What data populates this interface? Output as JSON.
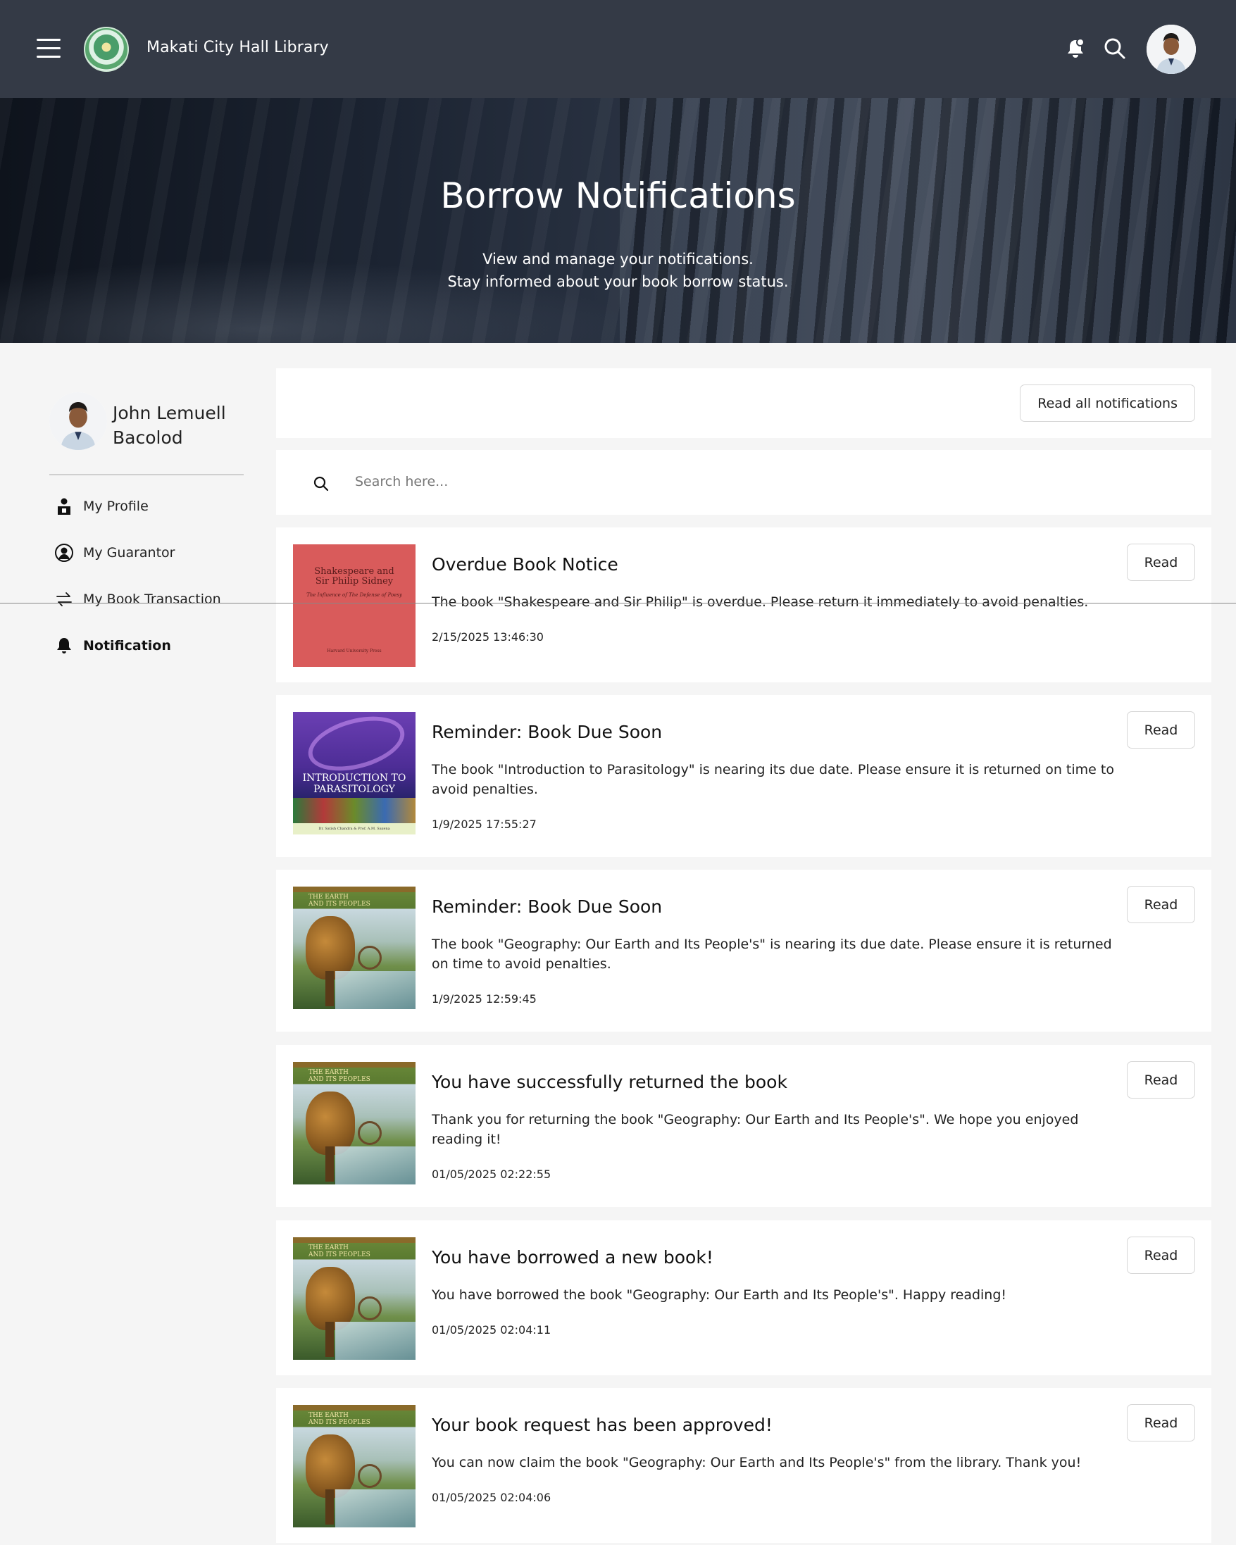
{
  "header": {
    "app_title": "Makati City Hall Library",
    "icons": [
      "menu-icon",
      "logo",
      "bell-icon",
      "search-icon",
      "avatar"
    ]
  },
  "hero": {
    "title": "Borrow Notifications",
    "subtitle_line1": "View and manage your notifications.",
    "subtitle_line2": "Stay informed about your book borrow status."
  },
  "sidebar": {
    "user_name": "John Lemuell Bacolod",
    "items": [
      {
        "label": "My Profile",
        "icon": "profile-icon",
        "active": false
      },
      {
        "label": "My Guarantor",
        "icon": "guarantor-icon",
        "active": false
      },
      {
        "label": "My Book Transaction",
        "icon": "transaction-icon",
        "active": false
      },
      {
        "label": "Notification",
        "icon": "bell-icon",
        "active": true
      }
    ]
  },
  "toolbar": {
    "read_all_label": "Read all notifications"
  },
  "search": {
    "placeholder": "Search here..."
  },
  "notifications": [
    {
      "title": "Overdue Book Notice",
      "message": "The book \"Shakespeare and Sir Philip\" is overdue. Please return it immediately to avoid penalties.",
      "time": "2/15/2025 13:46:30",
      "button": "Read",
      "cover": {
        "line1": "Shakespeare and",
        "line2": "Sir Philip Sidney",
        "subtitle": "The Influence of The Defense of Poesy",
        "footer": "Harvard University Press"
      }
    },
    {
      "title": "Reminder: Book Due Soon",
      "message": "The book \"Introduction to Parasitology\" is nearing its due date. Please ensure it is returned on time to avoid penalties.",
      "time": "1/9/2025 17:55:27",
      "button": "Read",
      "cover": {
        "line1": "INTRODUCTION TO",
        "line2": "PARASITOLOGY",
        "footer": "Dr. Satish Chandra & Prof. A.M. Saxena"
      }
    },
    {
      "title": "Reminder: Book Due Soon",
      "message": "The book \"Geography: Our Earth and Its People's\" is nearing its due date. Please ensure it is returned on time to avoid penalties.",
      "time": "1/9/2025 12:59:45",
      "button": "Read",
      "cover": {
        "line1": "THE EARTH",
        "line2": "AND ITS PEOPLES"
      }
    },
    {
      "title": "You have successfully returned the book",
      "message": "Thank you for returning the book \"Geography: Our Earth and Its People's\". We hope you enjoyed reading it!",
      "time": "01/05/2025 02:22:55",
      "button": "Read",
      "cover": {
        "line1": "THE EARTH",
        "line2": "AND ITS PEOPLES"
      }
    },
    {
      "title": "You have borrowed a new book!",
      "message": "You have borrowed the book \"Geography: Our Earth and Its People's\". Happy reading!",
      "time": "01/05/2025 02:04:11",
      "button": "Read",
      "cover": {
        "line1": "THE EARTH",
        "line2": "AND ITS PEOPLES"
      }
    },
    {
      "title": "Your book request has been approved!",
      "message": "You can now claim the book \"Geography: Our Earth and Its People's\" from the library. Thank you!",
      "time": "01/05/2025 02:04:06",
      "button": "Read",
      "cover": {
        "line1": "THE EARTH",
        "line2": "AND ITS PEOPLES"
      }
    }
  ],
  "colors": {
    "topbar": "#343a46",
    "page_bg": "#f5f5f5",
    "card_bg": "#ffffff"
  }
}
